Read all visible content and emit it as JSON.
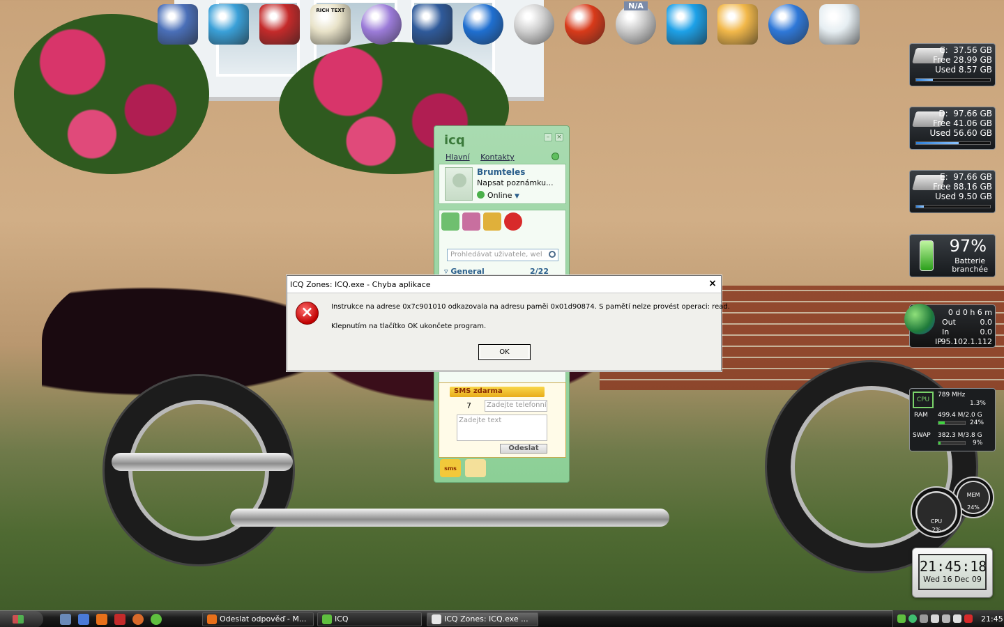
{
  "desktop": {
    "top_icons": [
      {
        "name": "my-computer-icon",
        "color": "#4a6fb8"
      },
      {
        "name": "trillian-icon",
        "color": "#3aa0d8"
      },
      {
        "name": "save-floppy-icon",
        "color": "#c42a2a"
      },
      {
        "name": "rich-text-editor-icon",
        "color": "#e8e2c8"
      },
      {
        "name": "music-player-icon",
        "color": "#9b7bd8"
      },
      {
        "name": "photo-viewer-icon",
        "color": "#2f5a9a"
      },
      {
        "name": "google-earth-icon",
        "color": "#1f6fd0"
      },
      {
        "name": "disc-burner-icon",
        "color": "#cfcfcf"
      },
      {
        "name": "ccleaner-icon",
        "color": "#d83a1a"
      },
      {
        "name": "na-weather-icon",
        "color": "#c9c9c9"
      },
      {
        "name": "skype-icon",
        "color": "#1da1e8"
      },
      {
        "name": "mail-icon",
        "color": "#f2b84a"
      },
      {
        "name": "firefox-icon",
        "color": "#2f78d8"
      },
      {
        "name": "recycle-bin-icon",
        "color": "#e6eef2"
      }
    ],
    "rich_text_label": "RICH TEXT",
    "na_label": "N/A"
  },
  "drives": [
    {
      "label": "C:",
      "size": "37.56 GB",
      "free": "Free 28.99 GB",
      "used": "Used 8.57 GB",
      "used_fraction": 0.23
    },
    {
      "label": "D:",
      "size": "97.66 GB",
      "free": "Free 41.06 GB",
      "used": "Used 56.60 GB",
      "used_fraction": 0.58
    },
    {
      "label": "E:",
      "size": "97.66 GB",
      "free": "Free 88.16 GB",
      "used": "Used 9.50 GB",
      "used_fraction": 0.1
    }
  ],
  "battery": {
    "percent": "97%",
    "line1": "Batterie",
    "line2": "branchée"
  },
  "network": {
    "uptime": "0 d 0 h 6 m",
    "out_label": "Out",
    "out_value": "0.0",
    "in_label": "In",
    "in_value": "0.0",
    "ip_label": "IP",
    "ip_value": "95.102.1.112"
  },
  "sysmon": {
    "cpu_label": "CPU",
    "cpu_freq": "789 MHz",
    "cpu_pct": "1.3%",
    "cpu_fraction": 0.013,
    "ram_label": "RAM",
    "ram_value": "499.4 M/2.0 G",
    "ram_pct": "24%",
    "ram_fraction": 0.24,
    "swap_label": "SWAP",
    "swap_value": "382.3 M/3.8 G",
    "swap_pct": "9%",
    "swap_fraction": 0.09
  },
  "gauges": {
    "cpu_label": "CPU",
    "cpu_value": "2%",
    "mem_label": "MEM",
    "mem_value": "24%"
  },
  "clock": {
    "time": "21:45:18",
    "date": "Wed 16 Dec 09"
  },
  "icq": {
    "logo": "icq",
    "tabs": [
      "Hlavní",
      "Kontakty"
    ],
    "username": "Brumteles",
    "note": "Napsat poznámku...",
    "status": "Online",
    "search_placeholder": "Prohledávat uživatele, wel",
    "group_name": "General",
    "group_count": "2/22",
    "sms_title": "SMS zdarma",
    "sms_prefix": "7",
    "sms_phone_placeholder": "Zadejte telefonní",
    "sms_text_placeholder": "Zadejte text",
    "sms_send": "Odeslat",
    "sms_tab": "sms"
  },
  "dialog": {
    "title": "ICQ Zones: ICQ.exe - Chyba aplikace",
    "close": "×",
    "message1": "Instrukce na adrese 0x7c901010 odkazovala na adresu paměi 0x01d90874. S pamětí nelze provést operaci: read.",
    "message2": "Klepnutím na tlačítko OK ukončete program.",
    "ok": "OK"
  },
  "taskbar": {
    "buttons": [
      {
        "label": "Odeslat odpověď - M...",
        "icon": "firefox-icon",
        "color": "#e8701a"
      },
      {
        "label": "ICQ",
        "icon": "icq-flower-icon",
        "color": "#5fbf3f"
      },
      {
        "label": "ICQ Zones: ICQ.exe ...",
        "icon": "error-window-icon",
        "color": "#e6e6e6"
      }
    ],
    "time": "21:45"
  }
}
